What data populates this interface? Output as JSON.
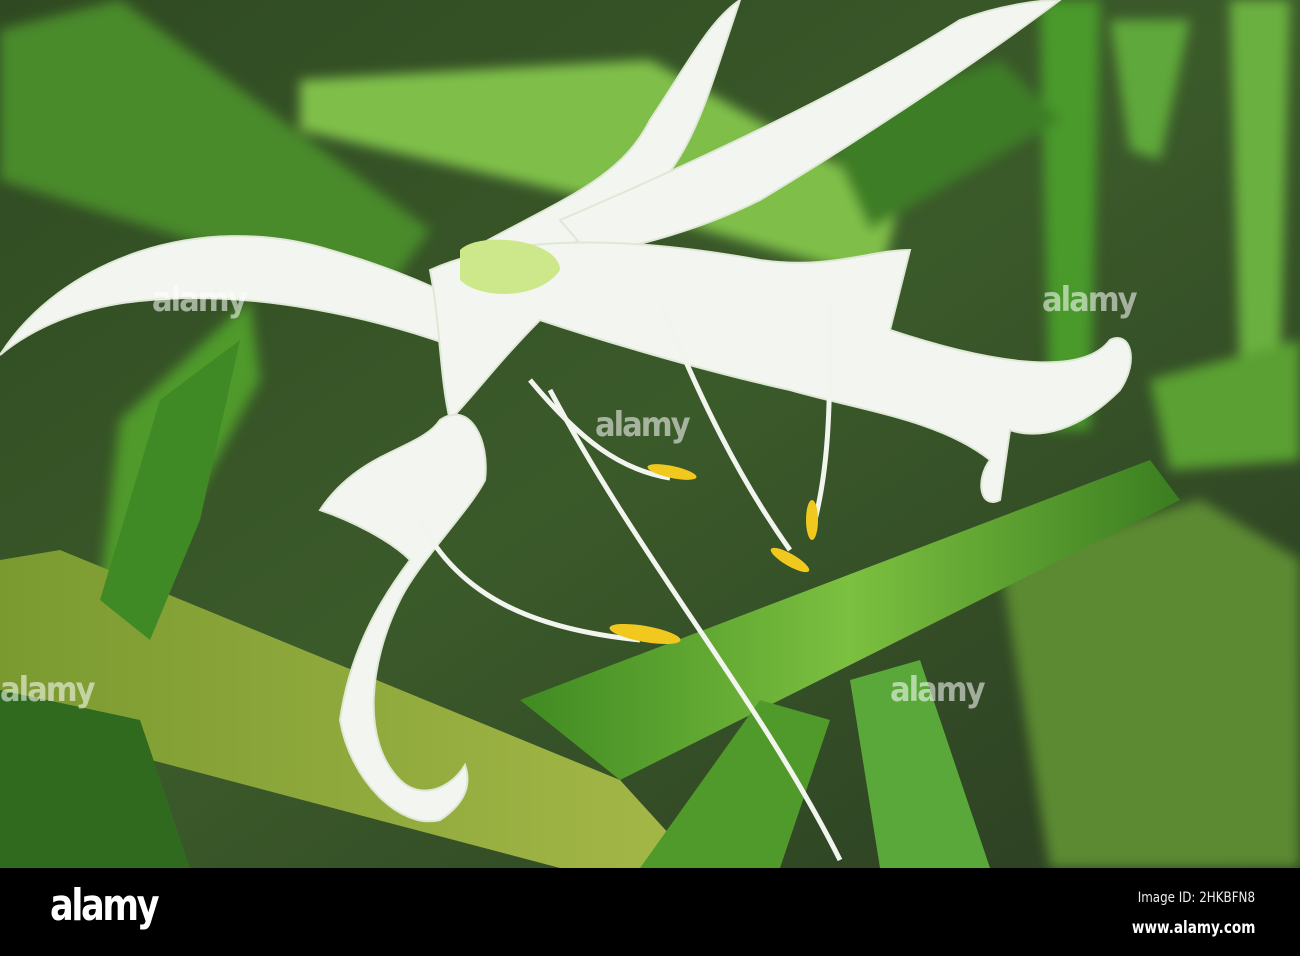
{
  "photo": {
    "subject": "white spider lily flower among green leaves",
    "watermark": "alamy"
  },
  "footer": {
    "logo": "alamy",
    "image_id": "Image ID: 2HKBFN8",
    "website": "www.alamy.com"
  },
  "colors": {
    "leaf": "#4f9a2a",
    "petal": "#f4f7f2",
    "anther": "#f0c81e",
    "bar": "#000000"
  }
}
